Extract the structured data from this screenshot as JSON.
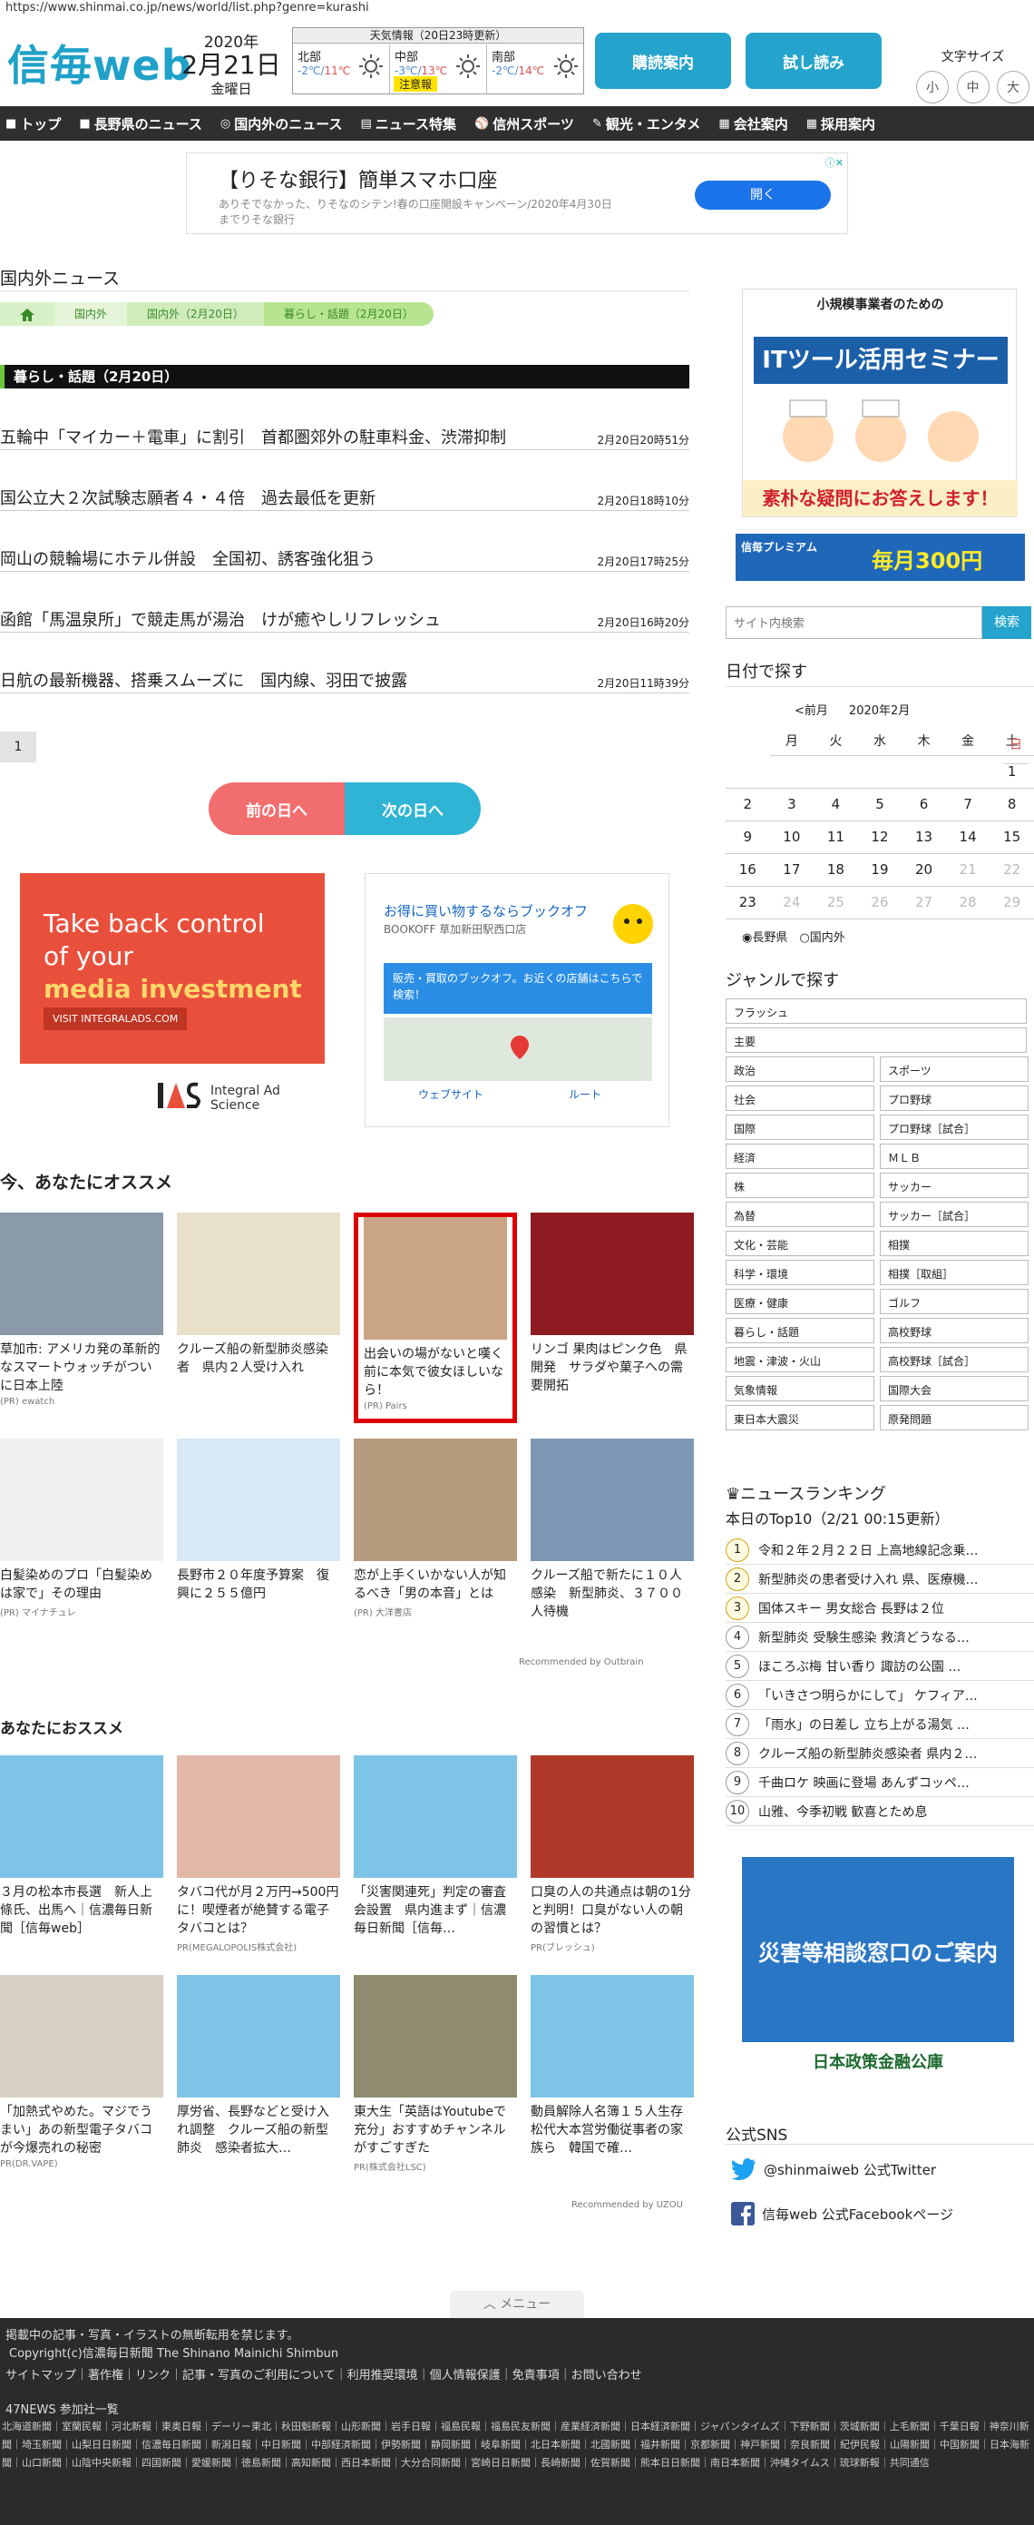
{
  "url": "https://www.shinmai.co.jp/news/world/list.php?genre=kurashi",
  "logo": {
    "ja": "信毎",
    "web": "web"
  },
  "date": {
    "year": "2020年",
    "md": "2月21日",
    "wd": "金曜日"
  },
  "weather": {
    "title": "天気情報（20日23時更新）",
    "areas": [
      {
        "name": "北部",
        "low": "-2℃",
        "high": "11℃"
      },
      {
        "name": "中部",
        "low": "-3℃",
        "high": "13℃",
        "warn": "注意報"
      },
      {
        "name": "南部",
        "low": "-2℃",
        "high": "14℃"
      }
    ]
  },
  "header_buttons": {
    "sale": "購読案内",
    "trial": "試し読み"
  },
  "font_size": {
    "label": "文字サイズ",
    "small": "小",
    "mid": "中",
    "large": "大"
  },
  "nav": [
    {
      "icon": "■",
      "label": "トップ"
    },
    {
      "icon": "■",
      "label": "長野県のニュース"
    },
    {
      "icon": "◎",
      "label": "国内外のニュース"
    },
    {
      "icon": "▤",
      "label": "ニュース特集"
    },
    {
      "icon": "⚾",
      "label": "信州スポーツ"
    },
    {
      "icon": "✎",
      "label": "観光・エンタメ"
    },
    {
      "icon": "▦",
      "label": "会社案内"
    },
    {
      "icon": "▦",
      "label": "採用案内"
    }
  ],
  "top_ad": {
    "title": "【りそな銀行】簡単スマホ口座",
    "sub": "ありそでなかった、りそなのシテン!春の口座開設キャンペーン/2020年4月30日までりそな銀行",
    "button": "開く"
  },
  "section_title": "国内外ニュース",
  "breadcrumb": [
    "国内外",
    "国内外（2月20日）",
    "暮らし・話題（2月20日）"
  ],
  "category": "暮らし・話題（2月20日）",
  "news": [
    {
      "title": "五輪中「マイカー＋電車」に割引　首都圏郊外の駐車料金、渋滞抑制",
      "date": "2月20日20時51分"
    },
    {
      "title": "国公立大２次試験志願者４・４倍　過去最低を更新",
      "date": "2月20日18時10分"
    },
    {
      "title": "岡山の競輪場にホテル併設　全国初、誘客強化狙う",
      "date": "2月20日17時25分"
    },
    {
      "title": "函館「馬温泉所」で競走馬が湯治　けが癒やしリフレッシュ",
      "date": "2月20日16時20分"
    },
    {
      "title": "日航の最新機器、搭乗スムーズに　国内線、羽田で披露",
      "date": "2月20日11時39分"
    }
  ],
  "page": "1",
  "day_nav": {
    "prev": "前の日へ",
    "next": "次の日へ"
  },
  "ad_ias": {
    "line1": "Take back control",
    "line2": "of your",
    "line3": "media investment",
    "visit": "VISIT INTEGRALADS.COM",
    "brand": "Integral Ad Science"
  },
  "ad_bookoff": {
    "t1": "お得に買い物するならブックオフ",
    "t2": "BOOKOFF 草加新田駅西口店",
    "box": "販売・買取のブックオフ。お近くの店舗はこちらで検索！",
    "web": "ウェブサイト",
    "route": "ルート"
  },
  "rec1_title": "今、あなたにオススメ",
  "rec1": [
    {
      "t": "草加市: アメリカ発の革新的なスマートウォッチがついに日本上陸",
      "pr": "(PR) ewatch",
      "img": "#8a9aa8"
    },
    {
      "t": "クルーズ船の新型肺炎感染者　県内２人受け入れ",
      "pr": "",
      "img": "#e8e0c8"
    },
    {
      "t": "出会いの場がないと嘆く前に本気で彼女ほしいなら！",
      "pr": "(PR) Pairs",
      "img": "#c9a485"
    },
    {
      "t": "リンゴ 果肉はピンク色　県開発　サラダや菓子への需要開拓",
      "pr": "",
      "img": "#8e1a22"
    },
    {
      "t": "白髪染めのプロ「白髪染めは家で」その理由",
      "pr": "(PR) マイナチュレ",
      "img": "#f0f0f0"
    },
    {
      "t": "長野市２０年度予算案　復興に２５５億円",
      "pr": "",
      "img": "#d8e8f4"
    },
    {
      "t": "恋が上手くいかない人が知るべき「男の本音」とは",
      "pr": "(PR) 大洋書店",
      "img": "#b59a7e"
    },
    {
      "t": "クルーズ船で新たに１０人感染　新型肺炎、３７００人待機",
      "pr": "",
      "img": "#7d98b5"
    }
  ],
  "outbrain": "Recommended by Outbrain",
  "rec2_title": "あなたにおススメ",
  "rec2": [
    {
      "t": "３月の松本市長選　新人上條氏、出馬へ｜信濃毎日新聞［信毎web］",
      "pr": "",
      "img": "#7dc4e6"
    },
    {
      "t": "タバコ代が月２万円→500円に！喫煙者が絶賛する電子タバコとは？",
      "pr": "PR(MEGALOPOLIS株式会社)",
      "img": "#e2b8a8"
    },
    {
      "t": "「災害関連死」判定の審査会設置　県内進まず｜信濃毎日新聞［信毎…",
      "pr": "",
      "img": "#7dc4e6"
    },
    {
      "t": "口臭の人の共通点は朝の1分と判明！口臭がない人の朝の習慣とは？",
      "pr": "PR(ブレッシュ)",
      "img": "#b0392a"
    },
    {
      "t": "「加熱式やめた。マジでうまい」あの新型電子タバコが今爆売れの秘密",
      "pr": "PR(DR.VAPE)",
      "img": "#d9cfc4"
    },
    {
      "t": "厚労省、長野などと受け入れ調整　クルーズ船の新型肺炎　感染者拡大…",
      "pr": "",
      "img": "#7dc4e6"
    },
    {
      "t": "東大生「英語はYoutubeで充分」おすすめチャンネルがすごすぎた",
      "pr": "PR(株式会社LSC)",
      "img": "#8f8a70"
    },
    {
      "t": "動員解除人名簿１５人生存　松代大本営労働従事者の家族ら　韓国で確…",
      "pr": "",
      "img": "#7dc4e6"
    }
  ],
  "uzou": "Recommended by UZOU",
  "side_ad1": {
    "head": "小規模事業者のための",
    "it": "ITツール活用セミナー",
    "foot": "素朴な疑問にお答えします！"
  },
  "side_ad2": {
    "a": "信毎プレミアム",
    "b": "毎月300円"
  },
  "search": {
    "placeholder": "サイト内検索",
    "button": "検索"
  },
  "cal": {
    "title": "日付で探す",
    "prev": "<前月",
    "month": "2020年2月",
    "wd": [
      "日",
      "月",
      "火",
      "水",
      "木",
      "金",
      "土"
    ],
    "rows": [
      [
        "",
        "",
        "",
        "",
        "",
        "",
        "1"
      ],
      [
        "2",
        "3",
        "4",
        "5",
        "6",
        "7",
        "8"
      ],
      [
        "9",
        "10",
        "11",
        "12",
        "13",
        "14",
        "15"
      ],
      [
        "16",
        "17",
        "18",
        "19",
        "20",
        "21",
        "22"
      ],
      [
        "23",
        "24",
        "25",
        "26",
        "27",
        "28",
        "29"
      ]
    ],
    "radio1": "長野県",
    "radio2": "国内外"
  },
  "genre_title": "ジャンルで探す",
  "genres": [
    "フラッシュ",
    "主要",
    "政治",
    "スポーツ",
    "社会",
    "プロ野球",
    "国際",
    "プロ野球［試合］",
    "経済",
    "ＭＬＢ",
    "株",
    "サッカー",
    "為替",
    "サッカー［試合］",
    "文化・芸能",
    "相撲",
    "科学・環境",
    "相撲［取組］",
    "医療・健康",
    "ゴルフ",
    "暮らし・話題",
    "高校野球",
    "地震・津波・火山",
    "高校野球［試合］",
    "気象情報",
    "国際大会",
    "東日本大震災",
    "原発問題"
  ],
  "ranking": {
    "title": "ニュースランキング",
    "sub": "本日のTop10（2/21 00:15更新）",
    "items": [
      "令和２年２月２２日 上高地線記念乗…",
      "新型肺炎の患者受け入れ 県、医療機…",
      "国体スキー 男女総合 長野は２位",
      "新型肺炎 受験生感染 救済どうなる…",
      "ほころぶ梅 甘い香り 諏訪の公園 …",
      "「いきさつ明らかにして」 ケフィア…",
      "「雨水」の日差し 立ち上がる湯気 …",
      "クルーズ船の新型肺炎感染者 県内２…",
      "千曲ロケ 映画に登場 あんずコッペ…",
      "山雅、今季初戦 歓喜とため息"
    ]
  },
  "side_ad3": {
    "main": "災害等相談窓口のご案内",
    "foot": "日本政策金融公庫"
  },
  "sns": {
    "title": "公式SNS",
    "twitter": "@shinmaiweb 公式Twitter",
    "facebook": "信毎web 公式Facebookページ"
  },
  "menu": "メニュー",
  "footer": {
    "l1": "掲載中の記事・写真・イラストの無断転用を禁じます。",
    "l2": "Copyright(c)信濃毎日新聞 The Shinano Mainichi Shimbun",
    "l3": "サイトマップ｜著作権｜リンク｜記事・写真のご利用について｜利用推奨環境｜個人情報保護｜免責事項｜お問い合わせ",
    "l4": "47NEWS 参加社一覧",
    "papers": "北海道新聞｜室蘭民報｜河北新報｜東奥日報｜デーリー東北｜秋田魁新報｜山形新聞｜岩手日報｜福島民報｜福島民友新聞｜産業経済新聞｜日本経済新聞｜ジャパンタイムズ｜下野新聞｜茨城新聞｜上毛新聞｜千葉日報｜神奈川新聞｜埼玉新聞｜山梨日日新聞｜信濃毎日新聞｜新潟日報｜中日新聞｜中部経済新聞｜伊勢新聞｜静岡新聞｜岐阜新聞｜北日本新聞｜北國新聞｜福井新聞｜京都新聞｜神戸新聞｜奈良新聞｜紀伊民報｜山陽新聞｜中国新聞｜日本海新聞｜山口新聞｜山陰中央新報｜四国新聞｜愛媛新聞｜徳島新聞｜高知新聞｜西日本新聞｜大分合同新聞｜宮崎日日新聞｜長崎新聞｜佐賀新聞｜熊本日日新聞｜南日本新聞｜沖縄タイムス｜琉球新報｜共同通信"
  }
}
